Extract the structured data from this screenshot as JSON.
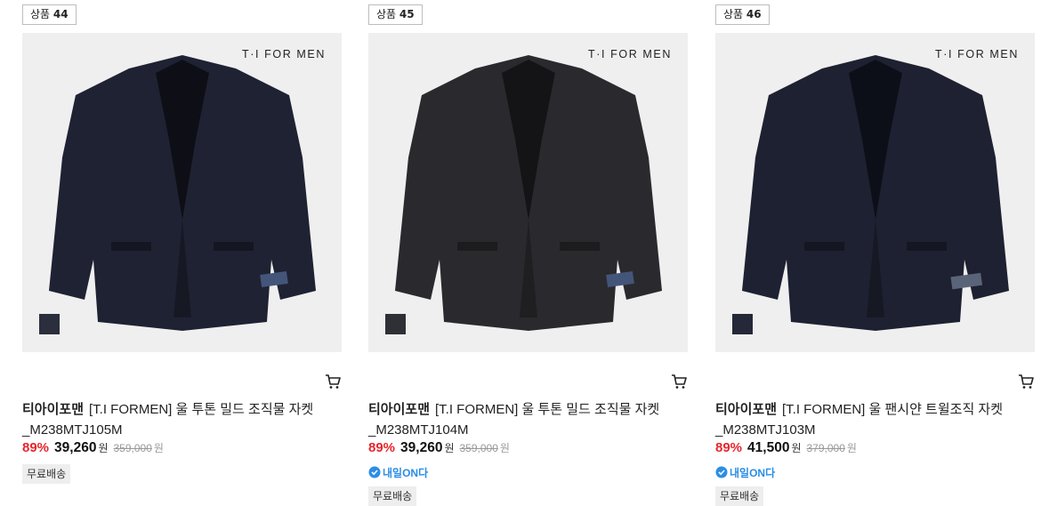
{
  "products": [
    {
      "badge_prefix": "상품",
      "badge_number": "44",
      "image_brand": "T·I FOR MEN",
      "brand": "티아이포맨",
      "name_line1": "[T.I FORMEN] 울 투톤 밀드 조직물 자켓",
      "name_line2": "_M238MTJ105M",
      "discount": "89%",
      "price": "39,260",
      "won": "원",
      "original_price": "359,000",
      "original_won": "원",
      "shipping": "무료배송",
      "jacket_color": "#1f2233",
      "swatch_color": "#2a2e3d"
    },
    {
      "badge_prefix": "상품",
      "badge_number": "45",
      "image_brand": "T·I FOR MEN",
      "brand": "티아이포맨",
      "name_line1": "[T.I FORMEN] 울 투톤 밀드 조직물 자켓",
      "name_line2": "_M238MTJ104M",
      "discount": "89%",
      "price": "39,260",
      "won": "원",
      "original_price": "359,000",
      "original_won": "원",
      "delivery_badge": "내일ON다",
      "shipping": "무료배송",
      "jacket_color": "#2a2a2e",
      "swatch_color": "#2f3035"
    },
    {
      "badge_prefix": "상품",
      "badge_number": "46",
      "image_brand": "T·I FOR MEN",
      "brand": "티아이포맨",
      "name_line1": "[T.I FORMEN] 울 팬시얀 트윌조직 자켓",
      "name_line2": "_M238MTJ103M",
      "discount": "89%",
      "price": "41,500",
      "won": "원",
      "original_price": "379,000",
      "original_won": "원",
      "delivery_badge": "내일ON다",
      "shipping": "무료배송",
      "jacket_color": "#1e2131",
      "swatch_color": "#242838"
    }
  ],
  "colors": {
    "discount_red": "#e8262c",
    "delivery_blue": "#2a8ee6"
  },
  "icons": {
    "cart": "cart-icon",
    "delivery": "delivery-check-icon"
  }
}
